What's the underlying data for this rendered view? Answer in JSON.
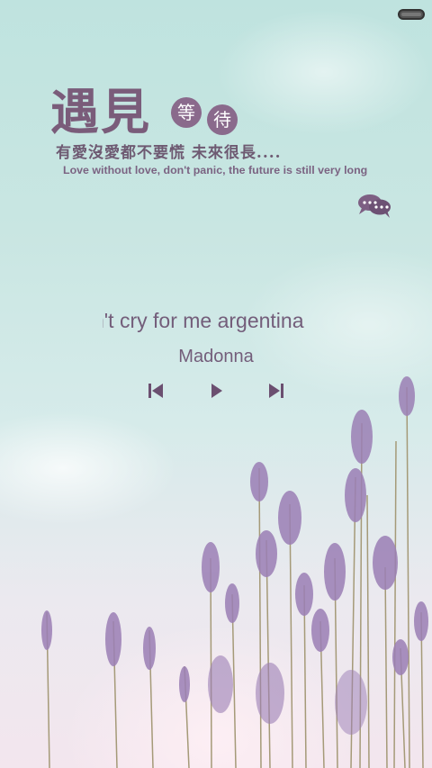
{
  "status_bar": {
    "battery_icon": "battery-icon"
  },
  "header": {
    "title_main": "遇見",
    "seal_1": "等",
    "seal_2": "待",
    "tagline_cn": "有愛沒愛都不要慌 未來很長....",
    "tagline_en": "Love without love, don't panic, the future is still very long"
  },
  "player": {
    "song_title": "n't cry for me argentina",
    "artist": "Madonna",
    "icons": {
      "prev": "skip-previous-icon",
      "play": "play-icon",
      "next": "skip-next-icon",
      "comment": "chat-bubbles-icon"
    }
  },
  "colors": {
    "accent": "#7a5c7a",
    "text": "#735d7a",
    "lavender": "#9b7fb5"
  }
}
